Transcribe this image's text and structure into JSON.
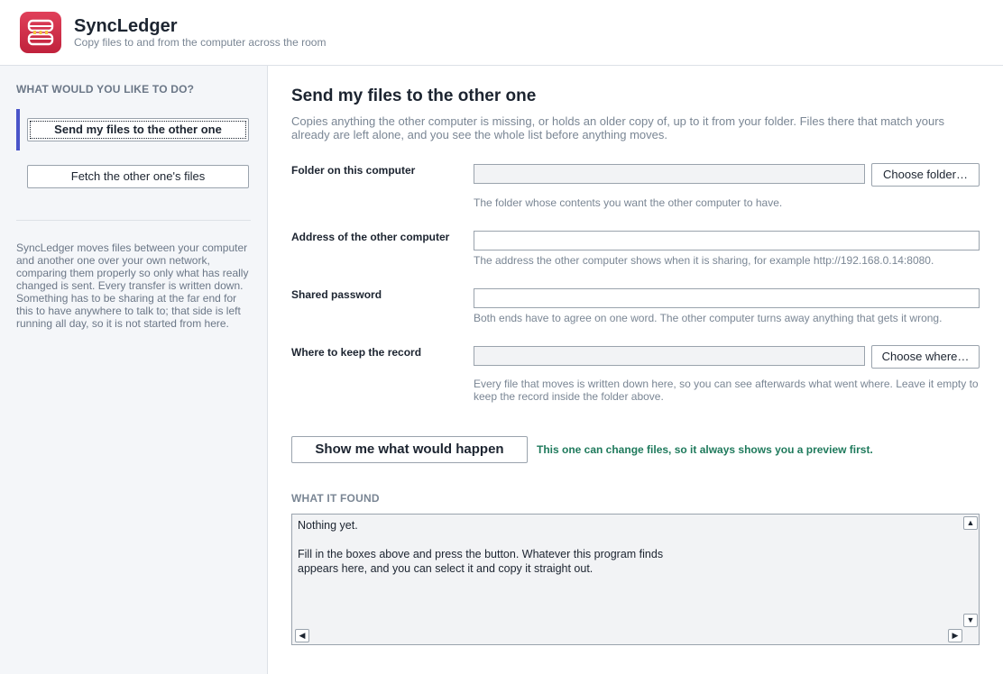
{
  "app": {
    "title": "SyncLedger",
    "subtitle": "Copy files to and from the computer across the room",
    "logo_icon": "ledger-sync-icon",
    "accent_color": "#d33550"
  },
  "sidebar": {
    "heading": "WHAT WOULD YOU LIKE TO DO?",
    "items": [
      {
        "label": "Send my files to the other one",
        "active": true
      },
      {
        "label": "Fetch the other one's files",
        "active": false
      }
    ],
    "about": "SyncLedger moves files between your computer and another one over your own network, comparing them properly so only what has really changed is sent. Every transfer is written down. Something has to be sharing at the far end for this to have anywhere to talk to; that side is left running all day, so it is not started from here."
  },
  "main": {
    "title": "Send my files to the other one",
    "description": "Copies anything the other computer is missing, or holds an older copy of, up to it from your folder. Files there that match yours already are left alone, and you see the whole list before anything moves.",
    "fields": {
      "folder": {
        "label": "Folder on this computer",
        "value": "",
        "button": "Choose folder…",
        "help": "The folder whose contents you want the other computer to have."
      },
      "address": {
        "label": "Address of the other computer",
        "value": "",
        "help": "The address the other computer shows when it is sharing, for example http://192.168.0.14:8080."
      },
      "password": {
        "label": "Shared password",
        "value": "",
        "help": "Both ends have to agree on one word. The other computer turns away anything that gets it wrong."
      },
      "record": {
        "label": "Where to keep the record",
        "value": "",
        "button": "Choose where…",
        "help": "Every file that moves is written down here, so you can see afterwards what went where. Leave it empty to keep the record inside the folder above."
      }
    },
    "preview_button": "Show me what would happen",
    "preview_note": "This one can change files, so it always shows you a preview first.",
    "preview_note_color": "#1f7a5c",
    "found_heading": "WHAT IT FOUND",
    "results_text": "Nothing yet.\n\nFill in the boxes above and press the button. Whatever this program finds\nappears here, and you can select it and copy it straight out."
  }
}
